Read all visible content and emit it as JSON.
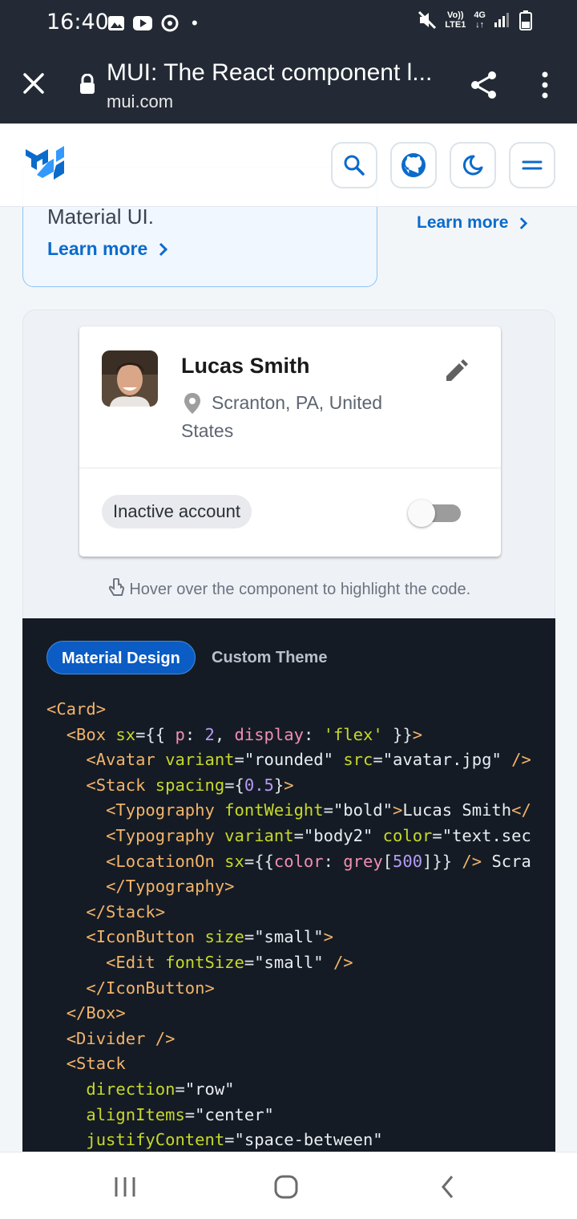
{
  "status_bar": {
    "time": "16:40",
    "dot": "•",
    "network_top": "Vo))",
    "network_bottom": "LTE1",
    "signal_type": "4G"
  },
  "browser": {
    "title": "MUI: The React component l...",
    "url": "mui.com"
  },
  "header": {
    "logo": "mui-logo"
  },
  "prev_card": {
    "text": "Material UI.",
    "learn_more": "Learn more",
    "learn_more_right": "Learn more"
  },
  "card": {
    "name": "Lucas Smith",
    "location": "Scranton, PA, United States",
    "chip": "Inactive account"
  },
  "hover_hint": "Hover over the component to highlight the code.",
  "code_tabs": {
    "active": "Material Design",
    "inactive": "Custom Theme"
  },
  "code": {
    "tokens": {
      "card_open": "<Card>",
      "box_tag": "<Box",
      "sx": "sx",
      "p_key": "p",
      "p_val": "2",
      "display_key": "display",
      "display_val": "'flex'",
      "avatar_tag": "<Avatar",
      "variant_attr": "variant",
      "avatar_variant": "\"rounded\"",
      "src_attr": "src",
      "avatar_src": "\"avatar.jpg\"",
      "stack_tag": "<Stack",
      "spacing_attr": "spacing",
      "spacing_val": "0.5",
      "typo_tag": "<Typography",
      "fontweight_attr": "fontWeight",
      "bold_val": "\"bold\"",
      "name_text": "Lucas Smith",
      "close_trunc": "</",
      "body2_val": "\"body2\"",
      "color_attr": "color",
      "color_val_trunc": "\"text.sec",
      "locicon_tag": "<LocationOn",
      "color_key": "color",
      "grey_fn": "grey",
      "grey_num": "500",
      "scra_text": "Scra",
      "typo_close": "</Typography>",
      "stack_close": "</Stack>",
      "iconbtn_tag": "<IconButton",
      "size_attr": "size",
      "small_val": "\"small\"",
      "edit_tag": "<Edit",
      "fontsize_attr": "fontSize",
      "iconbtn_close": "</IconButton>",
      "box_close": "</Box>",
      "divider_tag": "<Divider",
      "direction_attr": "direction",
      "row_val": "\"row\"",
      "alignitems_attr": "alignItems",
      "center_val": "\"center\"",
      "justify_attr": "justifyContent",
      "spacebetween_val": "\"space-between\""
    }
  },
  "colors": {
    "accent": "#0b6bcb",
    "dark": "#232a35",
    "code_bg": "#151b24"
  }
}
